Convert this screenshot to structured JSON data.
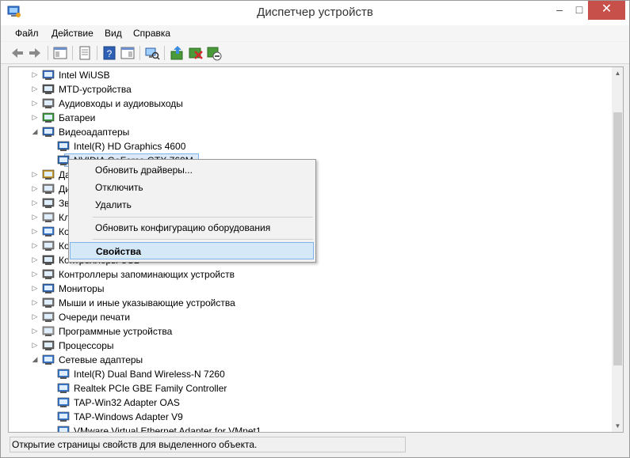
{
  "window": {
    "title": "Диспетчер устройств",
    "minimize": "–",
    "maximize": "□",
    "close": "✕"
  },
  "menu": [
    "Файл",
    "Действие",
    "Вид",
    "Справка"
  ],
  "tree": [
    {
      "label": "Intel WiUSB",
      "level": 1,
      "expander": "▷",
      "icon": "usb-device-icon"
    },
    {
      "label": "MTD-устройства",
      "level": 1,
      "expander": "▷",
      "icon": "mtd-device-icon"
    },
    {
      "label": "Аудиовходы и аудиовыходы",
      "level": 1,
      "expander": "▷",
      "icon": "speaker-icon"
    },
    {
      "label": "Батареи",
      "level": 1,
      "expander": "▷",
      "icon": "battery-icon"
    },
    {
      "label": "Видеоадаптеры",
      "level": 1,
      "expander": "◢",
      "icon": "display-adapter-icon"
    },
    {
      "label": "Intel(R) HD Graphics 4600",
      "level": 2,
      "expander": "",
      "icon": "display-adapter-icon"
    },
    {
      "label": "NVIDIA GeForce GTX 760M",
      "level": 2,
      "expander": "",
      "icon": "display-adapter-icon",
      "selected": true
    },
    {
      "label": "Да",
      "level": 1,
      "expander": "▷",
      "icon": "sensor-icon"
    },
    {
      "label": "Ди",
      "level": 1,
      "expander": "▷",
      "icon": "disk-drive-icon"
    },
    {
      "label": "Зв",
      "level": 1,
      "expander": "▷",
      "icon": "sound-icon"
    },
    {
      "label": "Кл",
      "level": 1,
      "expander": "▷",
      "icon": "keyboard-icon"
    },
    {
      "label": "Ко",
      "level": 1,
      "expander": "▷",
      "icon": "computer-icon"
    },
    {
      "label": "Ко",
      "level": 1,
      "expander": "▷",
      "icon": "controller-icon"
    },
    {
      "label": "Контроллеры USB",
      "level": 1,
      "expander": "▷",
      "icon": "usb-controller-icon"
    },
    {
      "label": "Контроллеры запоминающих устройств",
      "level": 1,
      "expander": "▷",
      "icon": "storage-controller-icon"
    },
    {
      "label": "Мониторы",
      "level": 1,
      "expander": "▷",
      "icon": "monitor-icon"
    },
    {
      "label": "Мыши и иные указывающие устройства",
      "level": 1,
      "expander": "▷",
      "icon": "mouse-icon"
    },
    {
      "label": "Очереди печати",
      "level": 1,
      "expander": "▷",
      "icon": "printer-icon"
    },
    {
      "label": "Программные устройства",
      "level": 1,
      "expander": "▷",
      "icon": "software-device-icon"
    },
    {
      "label": "Процессоры",
      "level": 1,
      "expander": "▷",
      "icon": "processor-icon"
    },
    {
      "label": "Сетевые адаптеры",
      "level": 1,
      "expander": "◢",
      "icon": "network-adapter-icon"
    },
    {
      "label": "Intel(R) Dual Band Wireless-N 7260",
      "level": 2,
      "expander": "",
      "icon": "network-adapter-icon"
    },
    {
      "label": "Realtek PCIe GBE Family Controller",
      "level": 2,
      "expander": "",
      "icon": "network-adapter-icon"
    },
    {
      "label": "TAP-Win32 Adapter OAS",
      "level": 2,
      "expander": "",
      "icon": "network-adapter-icon"
    },
    {
      "label": "TAP-Windows Adapter V9",
      "level": 2,
      "expander": "",
      "icon": "network-adapter-icon"
    },
    {
      "label": "VMware Virtual Ethernet Adapter for VMnet1",
      "level": 2,
      "expander": "",
      "icon": "network-adapter-icon"
    }
  ],
  "context_menu": {
    "update": "Обновить драйверы...",
    "disable": "Отключить",
    "delete": "Удалить",
    "scan": "Обновить конфигурацию оборудования",
    "properties": "Свойства"
  },
  "status": "Открытие страницы свойств для выделенного объекта.",
  "colors": {
    "selection": "#dbe9f8",
    "selection_border": "#7eb4ea",
    "close_button": "#c7504a"
  }
}
